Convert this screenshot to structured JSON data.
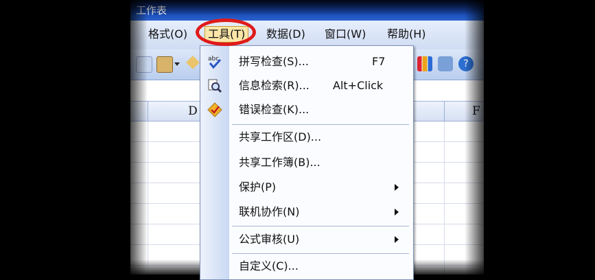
{
  "window": {
    "title": "工作表"
  },
  "menubar": {
    "items": [
      {
        "label": "格式(O)"
      },
      {
        "label": "工具(T)"
      },
      {
        "label": "数据(D)"
      },
      {
        "label": "窗口(W)"
      },
      {
        "label": "帮助(H)"
      }
    ]
  },
  "sheet": {
    "columns": [
      "D",
      "",
      "F"
    ]
  },
  "tools_menu": {
    "items": [
      {
        "label": "拼写检查(S)...",
        "shortcut": "F7",
        "icon": "spell-check-icon"
      },
      {
        "label": "信息检索(R)...",
        "shortcut": "Alt+Click",
        "icon": "research-icon"
      },
      {
        "label": "错误检查(K)...",
        "icon": "error-check-icon"
      },
      {
        "label": "共享工作区(D)..."
      },
      {
        "label": "共享工作簿(B)..."
      },
      {
        "label": "保护(P)",
        "submenu": true
      },
      {
        "label": "联机协作(N)",
        "submenu": true
      },
      {
        "label": "公式审核(U)",
        "submenu": true
      },
      {
        "label": "自定义(C)..."
      }
    ]
  },
  "colors": {
    "highlight_ring": "#e01a1a",
    "menu_active_bg": "#fbe6a8",
    "title_bar": "#1c4fb8"
  }
}
